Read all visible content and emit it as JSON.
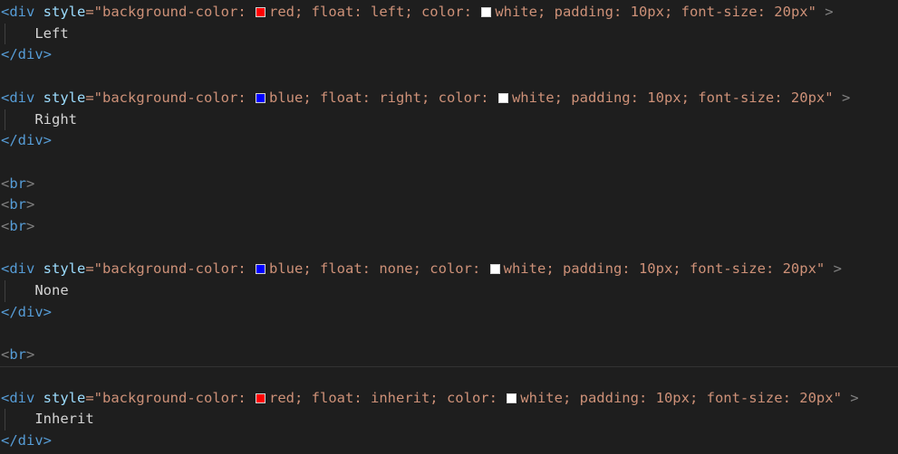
{
  "colors": {
    "red": "#ff0000",
    "blue": "#0000ff",
    "white": "#ffffff",
    "background": "#1e1e1e"
  },
  "blocks": [
    {
      "open": "<div",
      "attr": "style",
      "eq": "=\"",
      "prefix": "background-color: ",
      "bg": "red",
      "mid": "; float: left; color: ",
      "fg": "white",
      "suffix": "; padding: 10px; font-size: 20px\"",
      "close": ">",
      "content": "Left",
      "end": "</div>"
    },
    {
      "open": "<div",
      "attr": "style",
      "eq": "=\"",
      "prefix": "background-color: ",
      "bg": "blue",
      "mid": "; float: right; color: ",
      "fg": "white",
      "suffix": "; padding: 10px; font-size: 20px\"",
      "close": ">",
      "content": "Right",
      "end": "</div>"
    },
    {
      "open": "<div",
      "attr": "style",
      "eq": "=\"",
      "prefix": "background-color: ",
      "bg": "blue",
      "mid": "; float: none; color: ",
      "fg": "white",
      "suffix": "; padding: 10px; font-size: 20px\"",
      "close": ">",
      "content": "None",
      "end": "</div>"
    },
    {
      "open": "<div",
      "attr": "style",
      "eq": "=\"",
      "prefix": "background-color: ",
      "bg": "red",
      "mid": "; float: inherit; color: ",
      "fg": "white",
      "suffix": "; padding: 10px; font-size: 20px\"",
      "close": ">",
      "content": "Inherit",
      "end": "</div>"
    }
  ],
  "br": {
    "lt": "<",
    "name": "br",
    "gt": ">"
  }
}
